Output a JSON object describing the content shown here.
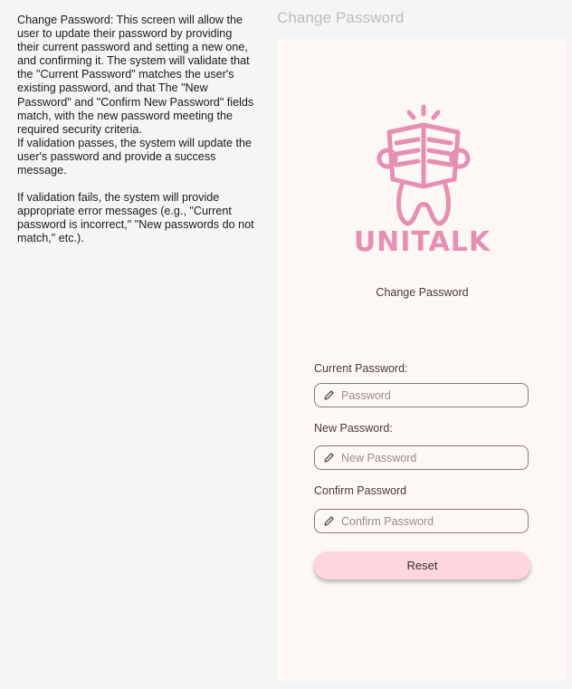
{
  "annotation": {
    "paragraph_1": "Change Password: This screen will allow the user to update their password by providing their current password and setting a new one, and confirming it. The system will validate that the \"Current Password\" matches the user's existing password, and that The \"New Password\" and \"Confirm New Password\" fields match, with the new password meeting the required security criteria.",
    "paragraph_2": "If validation passes, the system will update the user's password and provide a success message.",
    "paragraph_3": "If validation fails, the system will provide appropriate error messages (e.g., \"Current password is incorrect,\" \"New passwords do not match,\" etc.)."
  },
  "frame_title": "Change Password",
  "app": {
    "logo_text": "UNITALK",
    "brand_color": "#e78fb3",
    "heading": "Change Password"
  },
  "form": {
    "current": {
      "label": "Current Password:",
      "placeholder": "Password",
      "value": ""
    },
    "new": {
      "label": "New Password:",
      "placeholder": "New Password",
      "value": ""
    },
    "confirm": {
      "label": "Confirm Password",
      "placeholder": "Confirm Password",
      "value": ""
    },
    "reset_label": "Reset",
    "reset_color": "#ffd6e0",
    "field_icon": "pencil-icon"
  }
}
